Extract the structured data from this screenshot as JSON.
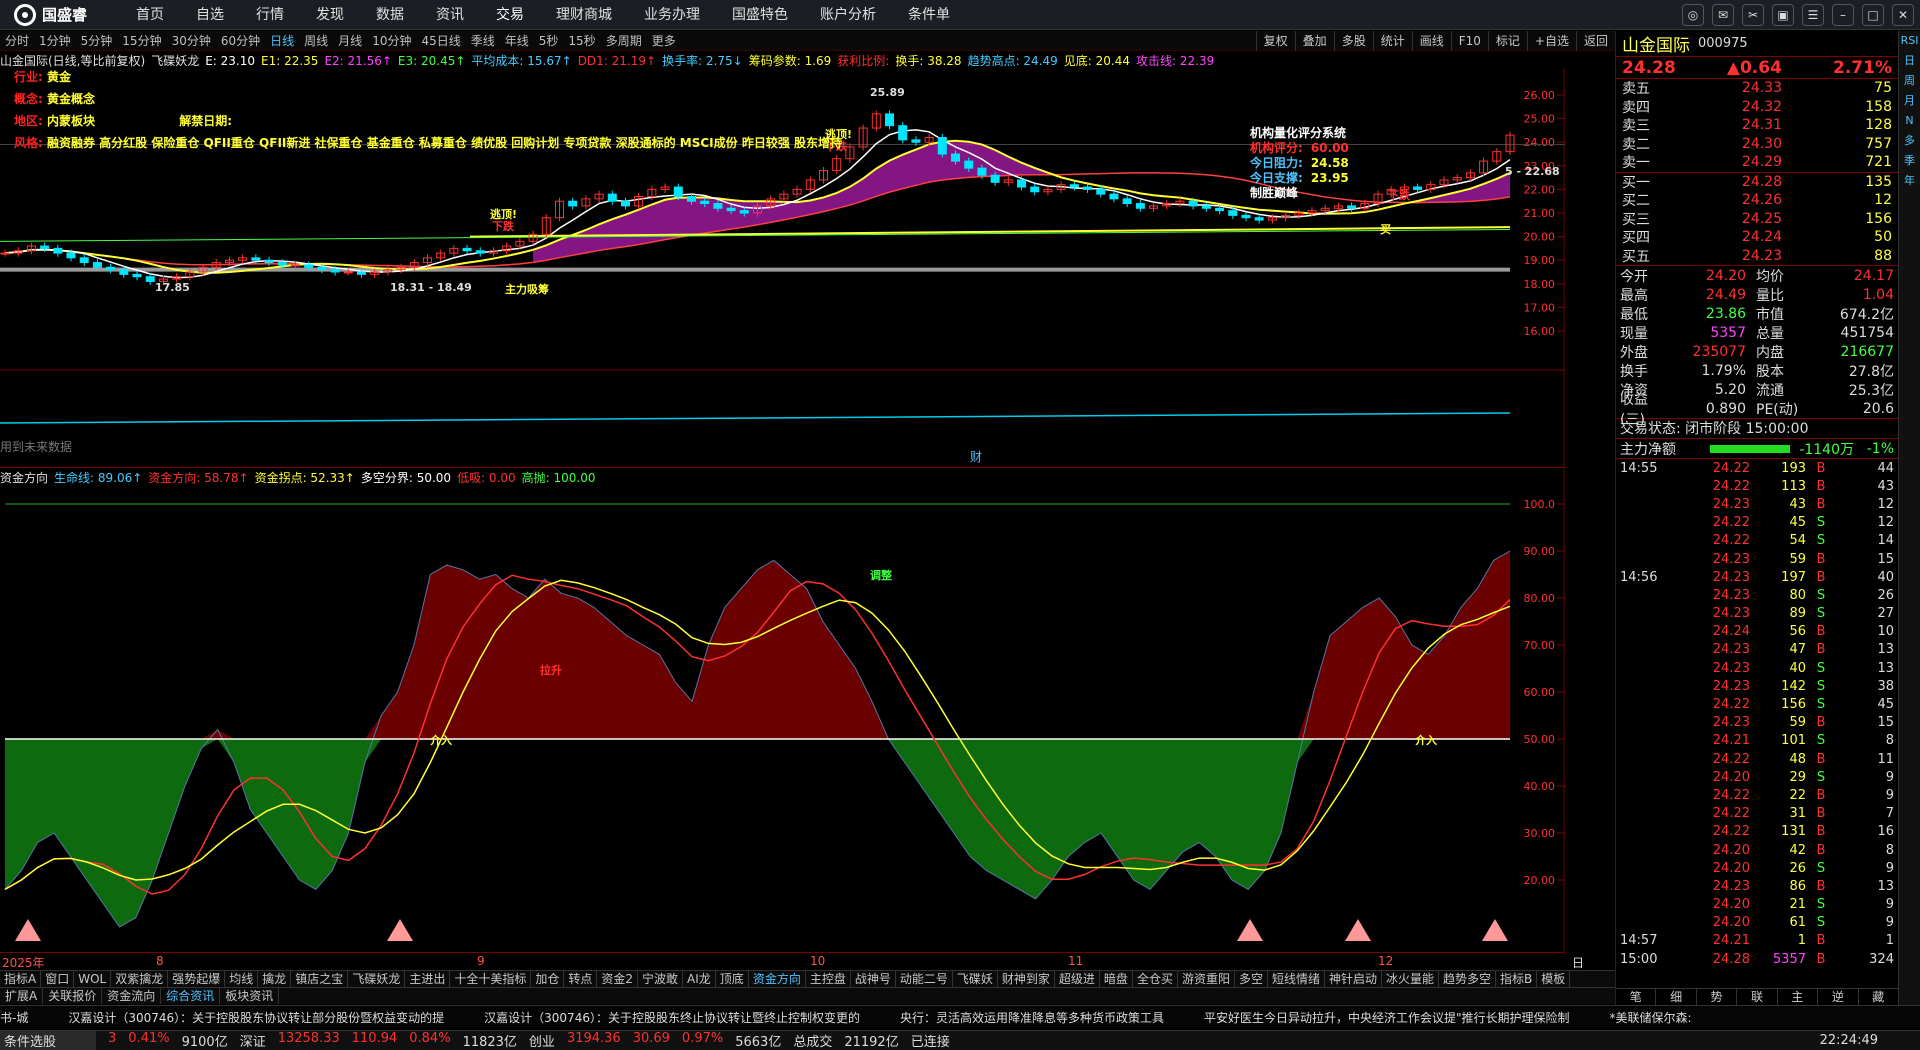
{
  "app": {
    "logo": "国盛睿",
    "menu": [
      "首页",
      "自选",
      "行情",
      "发现",
      "数据",
      "资讯",
      "交易",
      "理财商城",
      "业务办理",
      "国盛特色",
      "账户分析",
      "条件单"
    ],
    "active_menu": "交易"
  },
  "periods": {
    "items": [
      "分时",
      "1分钟",
      "5分钟",
      "15分钟",
      "30分钟",
      "60分钟",
      "日线",
      "周线",
      "月线",
      "10分钟",
      "45日线",
      "季线",
      "年线",
      "5秒",
      "15秒",
      "多周期",
      "更多"
    ],
    "active": "日线"
  },
  "toolbar_right": [
    "复权",
    "叠加",
    "多股",
    "统计",
    "画线",
    "F10",
    "标记",
    "+自选",
    "返回"
  ],
  "main_header": [
    {
      "t": "山金国际(日线,等比前复权)",
      "c": "#e0e0e0"
    },
    {
      "t": "飞碟妖龙",
      "c": "#e0e0e0"
    },
    {
      "t": "E: 23.10",
      "c": "#ffffff"
    },
    {
      "t": "E1: 22.35",
      "c": "#ffff33"
    },
    {
      "t": "E2: 21.56↑",
      "c": "#ff44ff"
    },
    {
      "t": "E3: 20.45↑",
      "c": "#44ff44"
    },
    {
      "t": "平均成本: 15.67↑",
      "c": "#44ccff"
    },
    {
      "t": "DD1: 21.19↑",
      "c": "#ff3030"
    },
    {
      "t": "换手率: 2.75↓",
      "c": "#44ccff"
    },
    {
      "t": "筹码参数: 1.69",
      "c": "#ffff33"
    },
    {
      "t": "获利比例:",
      "c": "#ff3030"
    },
    {
      "t": "换手: 38.28",
      "c": "#ffff33"
    },
    {
      "t": "趋势高点: 24.49",
      "c": "#44ccff"
    },
    {
      "t": "见底: 20.44",
      "c": "#ffff33"
    },
    {
      "t": "攻击线: 22.39",
      "c": "#ff44ff"
    }
  ],
  "info": {
    "industry_k": "行业:",
    "industry_v": "黄金",
    "concept_k": "概念:",
    "concept_v": "黄金概念",
    "region_k": "地区:",
    "region_v": "内蒙板块",
    "unlock_k": "解禁日期:",
    "style_k": "风格:",
    "style_v": "融资融券 高分红股 保险重仓 QFII重仓 QFII新进 社保重仓 基金重仓 私募重仓 绩优股 回购计划 专项贷款 深股通标的 MSCI成份 昨日较强 股东增持"
  },
  "main_chart": {
    "y_ticks": [
      "26.00",
      "25.00",
      "24.00",
      "23.00",
      "22.00",
      "21.00",
      "20.00",
      "19.00",
      "18.00",
      "17.00",
      "16.00"
    ],
    "high_label": "25.89",
    "low_label": "17.85",
    "range_label": "18.31 - 18.49",
    "right_label": "5 - 22.68",
    "annotations": [
      "逃顶!",
      "下跌",
      "主力吸筹",
      "逃顶!",
      "下跌",
      "下跌",
      "买"
    ],
    "system_title": "机构量化评分系统",
    "system_rows": [
      {
        "k": "机构评分:",
        "v": "60.00"
      },
      {
        "k": "今日阻力:",
        "v": "24.58"
      },
      {
        "k": "今日支撑:",
        "v": "23.95"
      },
      {
        "k": "制胜巅峰",
        "v": ""
      }
    ],
    "footer_text": "用到未来数据",
    "cai_label": "财"
  },
  "sub_header": [
    {
      "t": "资金方向",
      "c": "#e0e0e0"
    },
    {
      "t": "生命线: 89.06↑",
      "c": "#44ccff"
    },
    {
      "t": "资金方向: 58.78↑",
      "c": "#ff3030"
    },
    {
      "t": "资金拐点: 52.33↑",
      "c": "#ffff33"
    },
    {
      "t": "多空分界: 50.00",
      "c": "#ffffff"
    },
    {
      "t": "低吸: 0.00",
      "c": "#ff3030"
    },
    {
      "t": "高抛: 100.00",
      "c": "#44ff44"
    }
  ],
  "sub_chart": {
    "y_ticks": [
      "100.0",
      "90.00",
      "80.00",
      "70.00",
      "60.00",
      "50.00",
      "40.00",
      "30.00",
      "20.00"
    ],
    "labels": [
      "介入",
      "拉升",
      "调整",
      "介入"
    ]
  },
  "xaxis": {
    "labels": [
      "2025年",
      "8",
      "9",
      "10",
      "11",
      "12"
    ],
    "right": "日线"
  },
  "ind_tabs": [
    "指标A",
    "窗口",
    "WOL",
    "双紫擒龙",
    "强势起爆",
    "均线",
    "擒龙",
    "镇店之宝",
    "飞碟妖龙",
    "主进出",
    "十全十美指标",
    "加仓",
    "转点",
    "资金2",
    "宁波敢",
    "AI龙",
    "顶底",
    "资金方向",
    "主控盘",
    "战神号",
    "动能二号",
    "飞碟妖",
    "财神到家",
    "超级进",
    "暗盘",
    "全仓买",
    "游资重阳",
    "多空",
    "短线情绪",
    "神针启动",
    "冰火量能",
    "趋势多空",
    "指标B",
    "模板"
  ],
  "ind_active": "资金方向",
  "strip_tabs": [
    "扩展A",
    "关联报价",
    "资金流向",
    "综合资讯",
    "板块资讯"
  ],
  "strip_active": "综合资讯",
  "news": [
    "书-城",
    "汉嘉设计（300746）：关于控股股东协议转让部分股份暨权益变动的提",
    "汉嘉设计（300746）：关于控股股东终止协议转让暨终止控制权变更的",
    "央行：灵活高效运用降准降息等多种货币政策工具",
    "平安好医生今日异动拉升，中央经济工作会议提\"推行长期护理保险制",
    "*美联储保尔森:"
  ],
  "status": {
    "left": "条件选股",
    "items": [
      {
        "t": "3",
        "c": "#ff3030"
      },
      {
        "t": "0.41%",
        "c": "#ff3030"
      },
      {
        "t": "9100亿",
        "c": "#ddd"
      },
      {
        "t": "深证",
        "c": "#ddd"
      },
      {
        "t": "13258.33",
        "c": "#ff3030"
      },
      {
        "t": "110.94",
        "c": "#ff3030"
      },
      {
        "t": "0.84%",
        "c": "#ff3030"
      },
      {
        "t": "11823亿",
        "c": "#ddd"
      },
      {
        "t": "创业",
        "c": "#ddd"
      },
      {
        "t": "3194.36",
        "c": "#ff3030"
      },
      {
        "t": "30.69",
        "c": "#ff3030"
      },
      {
        "t": "0.97%",
        "c": "#ff3030"
      },
      {
        "t": "5663亿",
        "c": "#ddd"
      },
      {
        "t": "总成交",
        "c": "#ddd"
      },
      {
        "t": "21192亿",
        "c": "#ddd"
      },
      {
        "t": "已连接",
        "c": "#ddd"
      }
    ],
    "time": "22:24:49"
  },
  "quote": {
    "name": "山金国际",
    "code": "000975",
    "price": "24.28",
    "change": "▲0.64",
    "pct": "2.71%",
    "asks": [
      {
        "l": "卖五",
        "p": "24.33",
        "q": "75"
      },
      {
        "l": "卖四",
        "p": "24.32",
        "q": "158"
      },
      {
        "l": "卖三",
        "p": "24.31",
        "q": "128"
      },
      {
        "l": "卖二",
        "p": "24.30",
        "q": "757"
      },
      {
        "l": "卖一",
        "p": "24.29",
        "q": "721"
      }
    ],
    "bids": [
      {
        "l": "买一",
        "p": "24.28",
        "q": "135"
      },
      {
        "l": "买二",
        "p": "24.26",
        "q": "12"
      },
      {
        "l": "买三",
        "p": "24.25",
        "q": "156"
      },
      {
        "l": "买四",
        "p": "24.24",
        "q": "50"
      },
      {
        "l": "买五",
        "p": "24.23",
        "q": "88"
      }
    ],
    "stats": [
      {
        "l1": "今开",
        "v1": "24.20",
        "c1": "#ff3030",
        "l2": "均价",
        "v2": "24.17",
        "c2": "#ff3030"
      },
      {
        "l1": "最高",
        "v1": "24.49",
        "c1": "#ff3030",
        "l2": "量比",
        "v2": "1.04",
        "c2": "#ff3030"
      },
      {
        "l1": "最低",
        "v1": "23.86",
        "c1": "#44ff44",
        "l2": "市值",
        "v2": "674.2亿",
        "c2": "#ddd"
      },
      {
        "l1": "现量",
        "v1": "5357",
        "c1": "#ff44ff",
        "l2": "总量",
        "v2": "451754",
        "c2": "#ddd"
      },
      {
        "l1": "外盘",
        "v1": "235077",
        "c1": "#ff3030",
        "l2": "内盘",
        "v2": "216677",
        "c2": "#44ff44"
      },
      {
        "l1": "换手",
        "v1": "1.79%",
        "c1": "#ddd",
        "l2": "股本",
        "v2": "27.8亿",
        "c2": "#ddd"
      },
      {
        "l1": "净资",
        "v1": "5.20",
        "c1": "#ddd",
        "l2": "流通",
        "v2": "25.3亿",
        "c2": "#ddd"
      },
      {
        "l1": "收益(三)",
        "v1": "0.890",
        "c1": "#ddd",
        "l2": "PE(动)",
        "v2": "20.6",
        "c2": "#ddd"
      }
    ],
    "trade_state": "交易状态: 闭市阶段 15:00:00",
    "net_flow_label": "主力净额",
    "net_flow_value": "-1140万",
    "net_flow_pct": "-1%",
    "ticks": [
      {
        "t": "14:55",
        "p": "24.22",
        "v": "193",
        "bs": "B",
        "n": "44"
      },
      {
        "t": "",
        "p": "24.22",
        "v": "113",
        "bs": "B",
        "n": "43"
      },
      {
        "t": "",
        "p": "24.23",
        "v": "43",
        "bs": "B",
        "n": "12"
      },
      {
        "t": "",
        "p": "24.22",
        "v": "45",
        "bs": "S",
        "n": "12"
      },
      {
        "t": "",
        "p": "24.22",
        "v": "54",
        "bs": "S",
        "n": "14"
      },
      {
        "t": "",
        "p": "24.23",
        "v": "59",
        "bs": "B",
        "n": "15"
      },
      {
        "t": "14:56",
        "p": "24.23",
        "v": "197",
        "bs": "B",
        "n": "40"
      },
      {
        "t": "",
        "p": "24.23",
        "v": "80",
        "bs": "S",
        "n": "26"
      },
      {
        "t": "",
        "p": "24.23",
        "v": "89",
        "bs": "S",
        "n": "27"
      },
      {
        "t": "",
        "p": "24.24",
        "v": "56",
        "bs": "B",
        "n": "10"
      },
      {
        "t": "",
        "p": "24.23",
        "v": "47",
        "bs": "B",
        "n": "13"
      },
      {
        "t": "",
        "p": "24.23",
        "v": "40",
        "bs": "S",
        "n": "13"
      },
      {
        "t": "",
        "p": "24.23",
        "v": "142",
        "bs": "S",
        "n": "38"
      },
      {
        "t": "",
        "p": "24.22",
        "v": "156",
        "bs": "S",
        "n": "45"
      },
      {
        "t": "",
        "p": "24.23",
        "v": "59",
        "bs": "B",
        "n": "15"
      },
      {
        "t": "",
        "p": "24.21",
        "v": "101",
        "bs": "S",
        "n": "8"
      },
      {
        "t": "",
        "p": "24.22",
        "v": "48",
        "bs": "B",
        "n": "11"
      },
      {
        "t": "",
        "p": "24.20",
        "v": "29",
        "bs": "S",
        "n": "9"
      },
      {
        "t": "",
        "p": "24.22",
        "v": "22",
        "bs": "B",
        "n": "9"
      },
      {
        "t": "",
        "p": "24.22",
        "v": "31",
        "bs": "B",
        "n": "7"
      },
      {
        "t": "",
        "p": "24.22",
        "v": "131",
        "bs": "B",
        "n": "16"
      },
      {
        "t": "",
        "p": "24.20",
        "v": "42",
        "bs": "B",
        "n": "8"
      },
      {
        "t": "",
        "p": "24.20",
        "v": "26",
        "bs": "S",
        "n": "9"
      },
      {
        "t": "",
        "p": "24.23",
        "v": "86",
        "bs": "B",
        "n": "13"
      },
      {
        "t": "",
        "p": "24.20",
        "v": "21",
        "bs": "S",
        "n": "9"
      },
      {
        "t": "",
        "p": "24.20",
        "v": "61",
        "bs": "S",
        "n": "9"
      },
      {
        "t": "14:57",
        "p": "24.21",
        "v": "1",
        "bs": "B",
        "n": "1"
      },
      {
        "t": "15:00",
        "p": "24.28",
        "v": "5357",
        "bs": "B",
        "n": "324"
      }
    ],
    "tabs": [
      "笔",
      "细",
      "势",
      "联",
      "主",
      "逆",
      "藏"
    ]
  },
  "sidebar": [
    "RSI",
    "日",
    "周",
    "月",
    "N",
    "多",
    "季",
    "年"
  ],
  "colors": {
    "up": "#ff3030",
    "down": "#44ff44",
    "accent": "#4fc3ff",
    "panel_border": "#7a0000"
  }
}
